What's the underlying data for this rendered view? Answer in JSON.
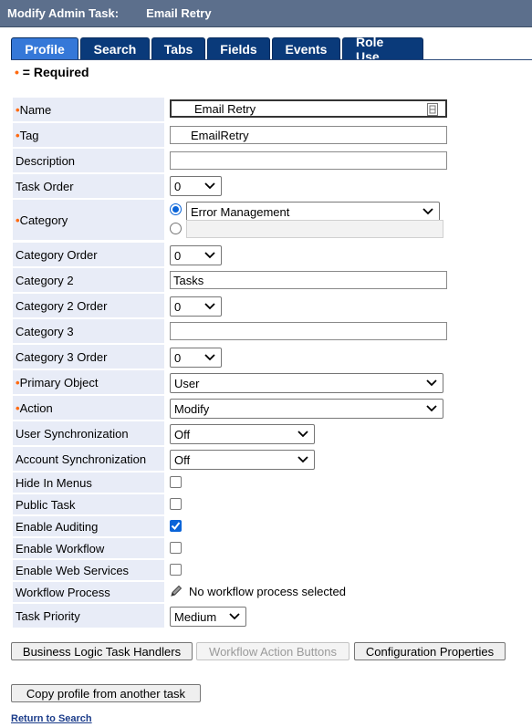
{
  "header": {
    "title_label": "Modify Admin Task:",
    "task_name": "Email Retry"
  },
  "tabs": [
    {
      "label": "Profile",
      "active": true
    },
    {
      "label": "Search"
    },
    {
      "label": "Tabs"
    },
    {
      "label": "Fields"
    },
    {
      "label": "Events"
    },
    {
      "label": "Role Use"
    }
  ],
  "required_note": {
    "marker": "•",
    "text": "= Required"
  },
  "form": {
    "name": {
      "label": "Name",
      "value": "Email Retry"
    },
    "tag": {
      "label": "Tag",
      "value": "EmailRetry"
    },
    "description": {
      "label": "Description",
      "value": ""
    },
    "task_order": {
      "label": "Task Order",
      "value": "0"
    },
    "category": {
      "label": "Category",
      "selected": "Error Management",
      "alt_value": ""
    },
    "category_order": {
      "label": "Category Order",
      "value": "0"
    },
    "category2": {
      "label": "Category 2",
      "value": "Tasks"
    },
    "category2_order": {
      "label": "Category 2 Order",
      "value": "0"
    },
    "category3": {
      "label": "Category 3",
      "value": ""
    },
    "category3_order": {
      "label": "Category 3 Order",
      "value": "0"
    },
    "primary_object": {
      "label": "Primary Object",
      "value": "User"
    },
    "action": {
      "label": "Action",
      "value": "Modify"
    },
    "user_sync": {
      "label": "User Synchronization",
      "value": "Off"
    },
    "account_sync": {
      "label": "Account Synchronization",
      "value": "Off"
    },
    "hide_in_menus": {
      "label": "Hide In Menus",
      "checked": false
    },
    "public_task": {
      "label": "Public Task",
      "checked": false
    },
    "enable_auditing": {
      "label": "Enable Auditing",
      "checked": true
    },
    "enable_workflow": {
      "label": "Enable Workflow",
      "checked": false
    },
    "enable_web_services": {
      "label": "Enable Web Services",
      "checked": false
    },
    "workflow_process": {
      "label": "Workflow Process",
      "value": "No workflow process selected"
    },
    "task_priority": {
      "label": "Task Priority",
      "value": "Medium"
    }
  },
  "buttons": {
    "business_logic": "Business Logic Task Handlers",
    "workflow_action": "Workflow Action Buttons",
    "config_props": "Configuration Properties",
    "copy_profile": "Copy profile from another task"
  },
  "links": {
    "return_to_search": "Return to Search"
  },
  "colors": {
    "title_bar": "#5c6f8c",
    "tab_active": "#3578d8",
    "tab_inactive": "#0a3a7a",
    "required_marker": "#ff6a10",
    "label_bg": "#e8ecf7",
    "link": "#1b3c8a"
  }
}
